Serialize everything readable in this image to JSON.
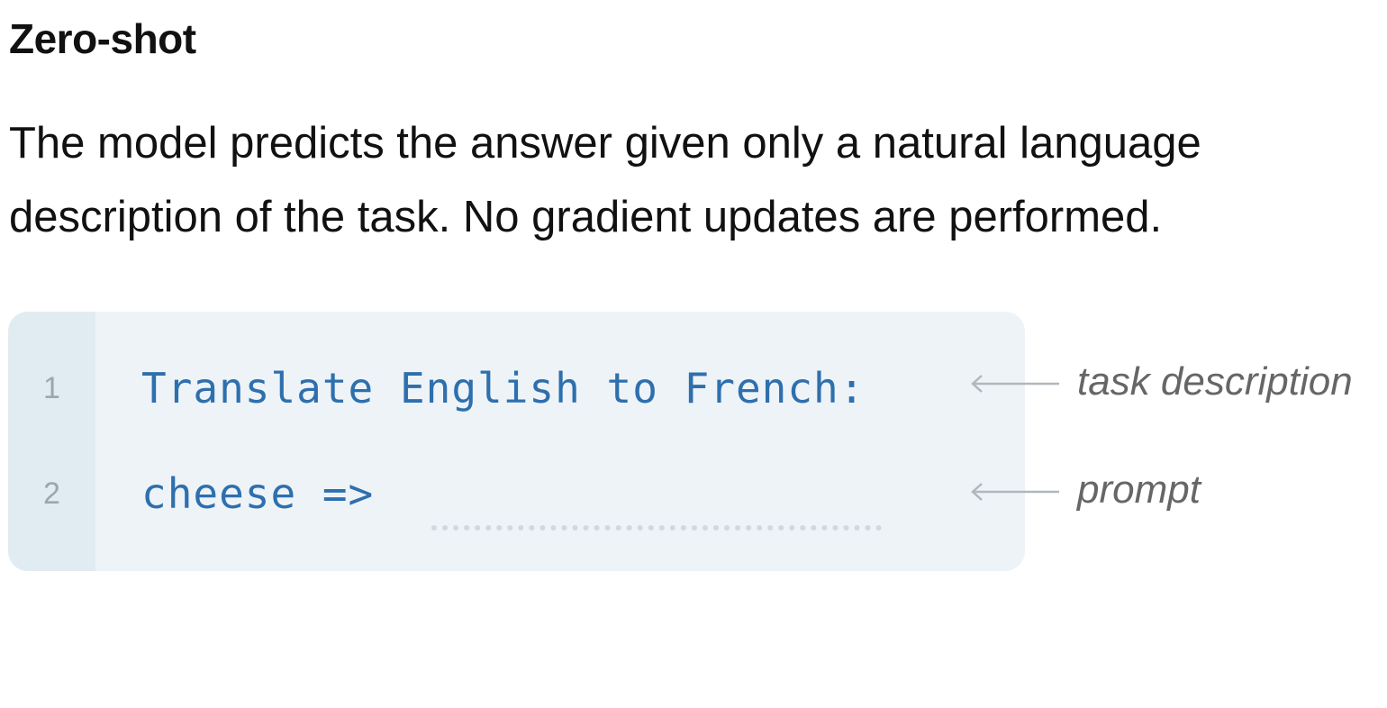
{
  "heading": {
    "title": "Zero-shot",
    "description": "The model predicts the answer given only a natural language description of the task. No gradient updates are performed."
  },
  "code_block": {
    "lines": [
      {
        "number": "1",
        "text": "Translate English to French:"
      },
      {
        "number": "2",
        "text": "cheese =>"
      }
    ]
  },
  "annotations": [
    {
      "label": "task description",
      "icon": "arrow-left-icon"
    },
    {
      "label": "prompt",
      "icon": "arrow-left-icon"
    }
  ],
  "colors": {
    "code_text": "#2e6fae",
    "code_background": "#edf3f7",
    "gutter_background": "#e1ebf2",
    "annotation_text": "#666666",
    "arrow": "#b0b8bd"
  }
}
